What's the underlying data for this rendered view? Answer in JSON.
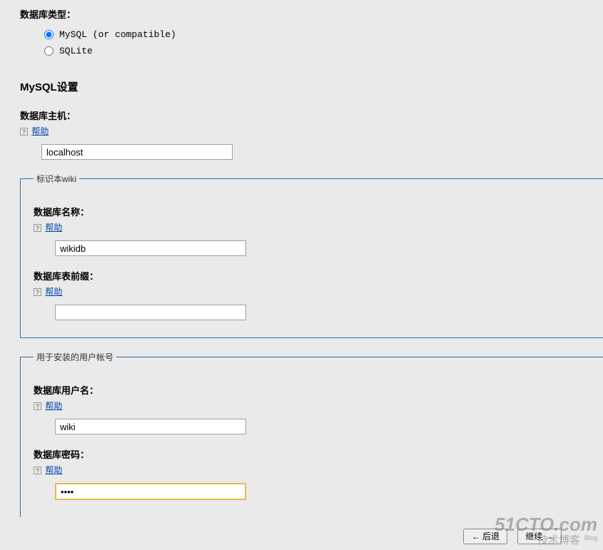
{
  "db_type": {
    "label": "数据库类型：",
    "options": {
      "mysql": "MySQL (or compatible)",
      "sqlite": "SQLite"
    },
    "selected": "mysql"
  },
  "mysql_section_title": "MySQL设置",
  "db_host": {
    "label": "数据库主机：",
    "help": "帮助",
    "value": "localhost"
  },
  "fieldset_identify": {
    "legend": "标识本wiki",
    "db_name": {
      "label": "数据库名称：",
      "help": "帮助",
      "value": "wikidb"
    },
    "table_prefix": {
      "label": "数据库表前缀：",
      "help": "帮助",
      "value": ""
    }
  },
  "fieldset_account": {
    "legend": "用于安装的用户帐号",
    "db_user": {
      "label": "数据库用户名：",
      "help": "帮助",
      "value": "wiki"
    },
    "db_pass": {
      "label": "数据库密码：",
      "help": "帮助",
      "value": "••••"
    }
  },
  "buttons": {
    "back": "← 后退",
    "continue": "继续 →"
  },
  "watermark": {
    "line1": "51CTO.com",
    "line2": "技术博客",
    "line2_sub": "Blog"
  }
}
